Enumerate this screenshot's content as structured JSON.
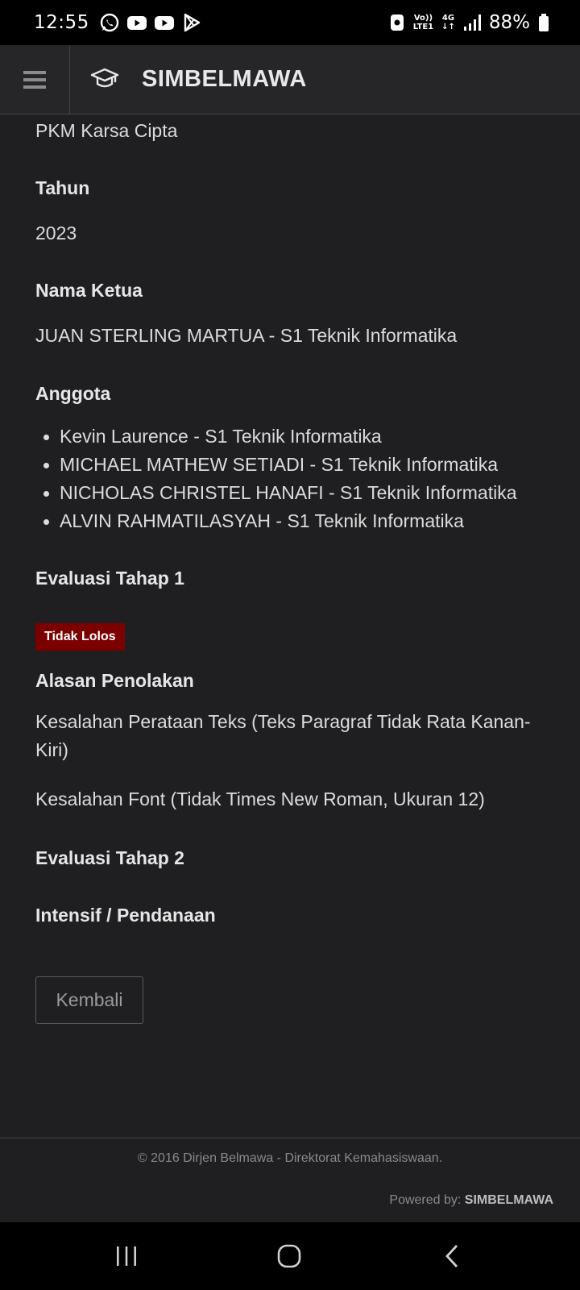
{
  "status_bar": {
    "time": "12:55",
    "network_top": "Vo))",
    "network_bottom": "LTE1",
    "signal_type": "4G",
    "battery": "88%"
  },
  "header": {
    "brand": "SIMBELMAWA",
    "menu_icon": "hamburger-icon",
    "logo_icon": "graduation-cap-icon"
  },
  "detail": {
    "skema_value": "PKM Karsa Cipta",
    "tahun_label": "Tahun",
    "tahun_value": "2023",
    "ketua_label": "Nama Ketua",
    "ketua_value": "JUAN STERLING MARTUA - S1 Teknik Informatika",
    "anggota_label": "Anggota",
    "anggota": [
      "Kevin Laurence - S1 Teknik Informatika",
      "MICHAEL MATHEW SETIADI - S1 Teknik Informatika",
      "NICHOLAS CHRISTEL HANAFI - S1 Teknik Informatika",
      "ALVIN RAHMATILASYAH - S1 Teknik Informatika"
    ],
    "eval1_label": "Evaluasi Tahap 1",
    "eval1_status": "Tidak Lolos",
    "alasan_label": "Alasan Penolakan",
    "alasan": [
      "Kesalahan Perataan Teks (Teks Paragraf Tidak Rata Kanan-Kiri)",
      "Kesalahan Font (Tidak Times New Roman, Ukuran 12)"
    ],
    "eval2_label": "Evaluasi Tahap 2",
    "pendanaan_label": "Intensif / Pendanaan",
    "back_button": "Kembali"
  },
  "footer": {
    "copyright": "© 2016 Dirjen Belmawa - Direktorat Kemahasiswaan.",
    "powered_prefix": "Powered by: ",
    "powered_brand": "SIMBELMAWA"
  },
  "colors": {
    "background": "#1f1f21",
    "header": "#262628",
    "badge_red": "#7b0000"
  }
}
